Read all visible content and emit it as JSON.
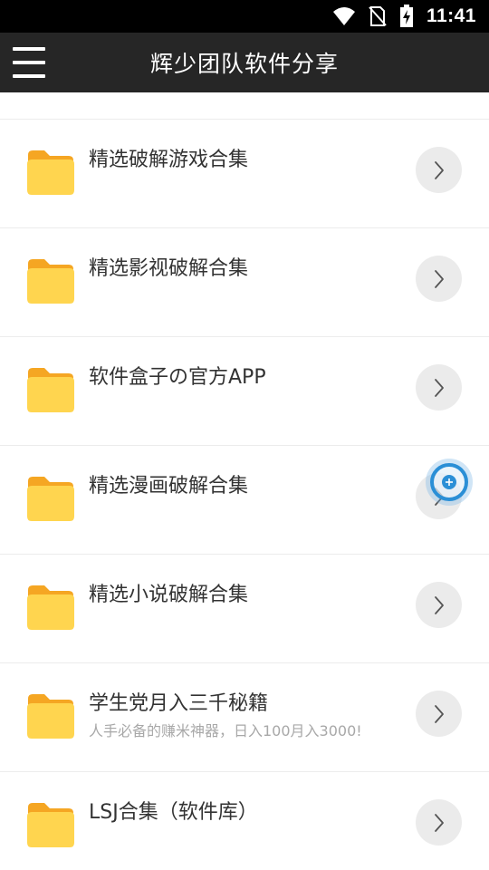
{
  "status_bar": {
    "time": "11:41",
    "icons": [
      "wifi-icon",
      "no-sim-icon",
      "battery-charging-icon"
    ]
  },
  "app_bar": {
    "title": "辉少团队软件分享",
    "menu_icon": "hamburger-menu-icon"
  },
  "colors": {
    "status_bar_bg": "#000000",
    "app_bar_bg": "#262626",
    "folder_back": "#f5a623",
    "folder_front": "#ffd54f",
    "chevron_bg": "#ebebeb",
    "floating_accent": "#2b8fd6"
  },
  "items": [
    {
      "title": "精选破解游戏合集",
      "subtitle": ""
    },
    {
      "title": "精选影视破解合集",
      "subtitle": ""
    },
    {
      "title": "软件盒子の官方APP",
      "subtitle": ""
    },
    {
      "title": "精选漫画破解合集",
      "subtitle": ""
    },
    {
      "title": "精选小说破解合集",
      "subtitle": ""
    },
    {
      "title": "学生党月入三千秘籍",
      "subtitle": "人手必备的赚米神器，日入100月入3000!"
    },
    {
      "title": "LSJ合集（软件库）",
      "subtitle": ""
    }
  ],
  "floating_button": {
    "icon": "assistive-touch-icon"
  }
}
